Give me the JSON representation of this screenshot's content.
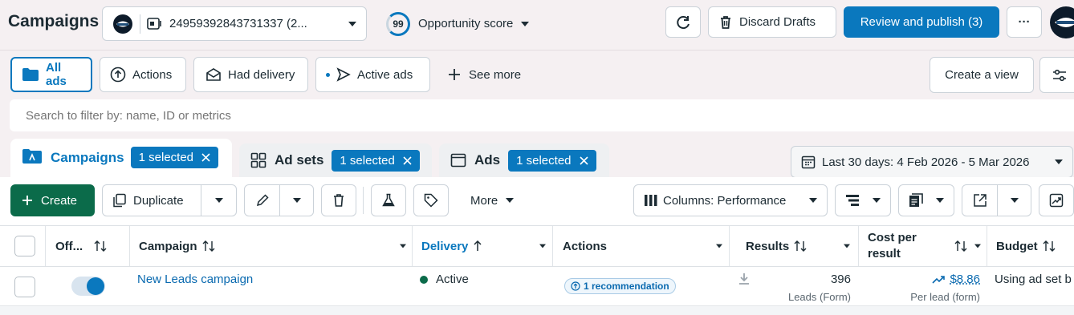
{
  "topbar": {
    "page_title": "Campaigns",
    "account_id": "24959392843731337 (2...",
    "opportunity_score": "99",
    "opportunity_label": "Opportunity score",
    "discard_label": "Discard Drafts",
    "review_label": "Review and publish (3)",
    "more_label": "···"
  },
  "views": {
    "tabs": [
      "All ads",
      "Actions",
      "Had delivery",
      "Active ads"
    ],
    "see_more": "See more",
    "create_view": "Create a view"
  },
  "search": {
    "placeholder": "Search to filter by: name, ID or metrics"
  },
  "levels": {
    "campaigns": {
      "label": "Campaigns",
      "selected": "1 selected"
    },
    "adsets": {
      "label": "Ad sets",
      "selected": "1 selected"
    },
    "ads": {
      "label": "Ads",
      "selected": "1 selected"
    },
    "date_range": "Last 30 days: 4 Feb 2026 - 5 Mar 2026"
  },
  "toolbar": {
    "create": "Create",
    "duplicate": "Duplicate",
    "more": "More",
    "columns": "Columns: Performance"
  },
  "table": {
    "headers": {
      "toggle": "Off...",
      "campaign": "Campaign",
      "delivery": "Delivery",
      "actions": "Actions",
      "results": "Results",
      "cost_line1": "Cost per",
      "cost_line2": "result",
      "budget": "Budget"
    },
    "rows": [
      {
        "name": "New Leads campaign",
        "delivery": "Active",
        "actions": "1 recommendation",
        "results": "396",
        "results_sub": "Leads (Form)",
        "cost": "$8.86",
        "cost_sub": "Per lead (form)",
        "budget": "Using ad set b"
      }
    ]
  },
  "colors": {
    "primary": "#0a78be",
    "create_green": "#0b6b4a",
    "active_dot": "#0b6b4a"
  }
}
